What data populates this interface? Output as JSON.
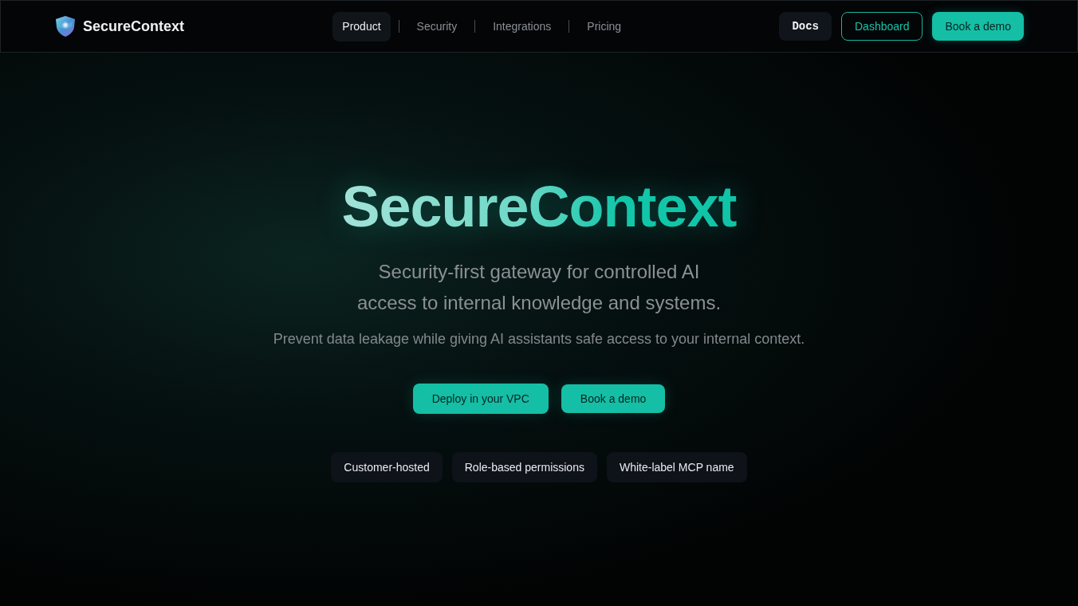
{
  "header": {
    "logo": {
      "name": "SecureContext"
    },
    "nav": [
      {
        "label": "Product",
        "selected": true
      },
      {
        "label": "Security",
        "selected": false
      },
      {
        "label": "Integrations",
        "selected": false
      },
      {
        "label": "Pricing",
        "selected": false
      }
    ],
    "actions": [
      {
        "label": "Docs",
        "kind": "dark"
      },
      {
        "label": "Dashboard",
        "kind": "outline"
      },
      {
        "label": "Book a demo",
        "kind": "primary"
      }
    ]
  },
  "hero": {
    "title": "SecureContext",
    "subtitle": "Security-first gateway for controlled AI access to internal knowledge and systems.",
    "description": "Prevent data leakage while giving AI assistants safe access to your internal context.",
    "buttons": [
      {
        "label": "Deploy in your VPC",
        "kind": "primary"
      },
      {
        "label": "Book a demo",
        "kind": "primary"
      }
    ],
    "features": [
      "Customer-hosted",
      "Role-based permissions",
      "White-label MCP name"
    ]
  }
}
